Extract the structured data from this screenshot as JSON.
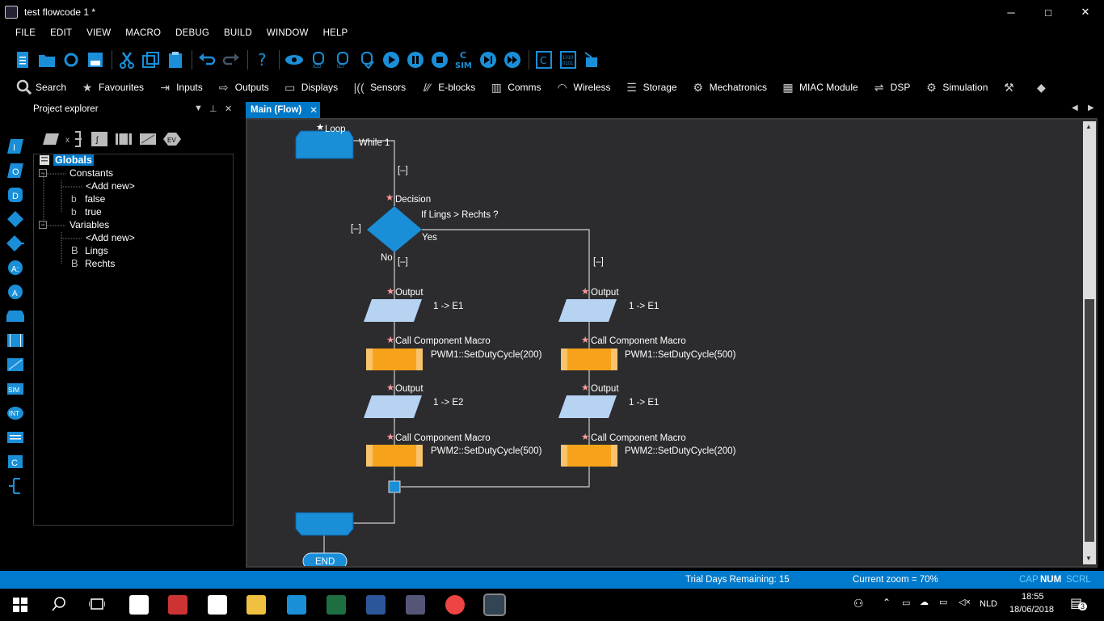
{
  "window": {
    "title": "test flowcode 1 *",
    "minimize": "─",
    "maximize": "□",
    "close": "✕"
  },
  "menu": [
    "FILE",
    "EDIT",
    "VIEW",
    "MACRO",
    "DEBUG",
    "BUILD",
    "WINDOW",
    "HELP"
  ],
  "toolbar_categories": [
    "Search",
    "Favourites",
    "Inputs",
    "Outputs",
    "Displays",
    "Sensors",
    "E-blocks",
    "Comms",
    "Wireless",
    "Storage",
    "Mechatronics",
    "MIAC Module",
    "DSP",
    "Simulation"
  ],
  "explorer": {
    "title": "Project explorer",
    "tree": {
      "root": "Globals",
      "constants_label": "Constants",
      "constants": [
        "<Add new>",
        "false",
        "true"
      ],
      "variables_label": "Variables",
      "variables": [
        "<Add new>",
        "Lings",
        "Rechts"
      ]
    }
  },
  "editor": {
    "tab_label": "Main (Flow)",
    "tab_close": "✕",
    "flow": {
      "loop_label": "Loop",
      "loop_condition": "While 1",
      "collapse": "[–]",
      "decision_label": "Decision",
      "decision_condition": "If Lings > Rechts ?",
      "yes": "Yes",
      "no": "No",
      "left": {
        "output1_label": "Output",
        "output1_value": "1 -> E1",
        "call1_label": "Call Component Macro",
        "call1_value": "PWM1::SetDutyCycle(200)",
        "output2_label": "Output",
        "output2_value": "1 -> E2",
        "call2_label": "Call Component Macro",
        "call2_value": "PWM2::SetDutyCycle(500)"
      },
      "right": {
        "output1_label": "Output",
        "output1_value": "1 -> E1",
        "call1_label": "Call Component Macro",
        "call1_value": "PWM1::SetDutyCycle(500)",
        "output2_label": "Output",
        "output2_value": "1 -> E1",
        "call2_label": "Call Component Macro",
        "call2_value": "PWM2::SetDutyCycle(200)"
      },
      "end_label": "END"
    }
  },
  "status": {
    "trial": "Trial Days Remaining: 15",
    "zoom": "Current zoom = 70%",
    "cap": "CAP",
    "num": "NUM",
    "scrl": "SCRL"
  },
  "taskbar": {
    "lang": "NLD",
    "time": "18:55",
    "date": "18/06/2018",
    "notifications": "3"
  },
  "colors": {
    "accent": "#007acc",
    "flow_blue": "#1a8fd8",
    "flow_orange": "#f7a21b",
    "canvas_bg": "#2c2c2f"
  }
}
